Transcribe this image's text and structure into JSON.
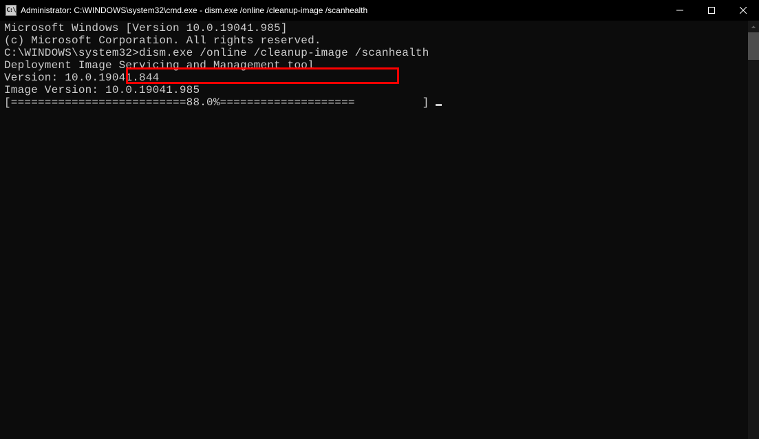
{
  "window": {
    "title": "Administrator: C:\\WINDOWS\\system32\\cmd.exe - dism.exe  /online /cleanup-image /scanhealth"
  },
  "terminal": {
    "line1": "Microsoft Windows [Version 10.0.19041.985]",
    "line2": "(c) Microsoft Corporation. All rights reserved.",
    "blank1": "",
    "promptPrefix": "C:\\WINDOWS\\system32>",
    "command": "dism.exe /online /cleanup-image /scanhealth",
    "blank2": "",
    "toolName": "Deployment Image Servicing and Management tool",
    "toolVersion": "Version: 10.0.19041.844",
    "blank3": "",
    "imageVersion": "Image Version: 10.0.19041.985",
    "blank4": "",
    "progressBar": "[==========================88.0%====================          ] "
  }
}
